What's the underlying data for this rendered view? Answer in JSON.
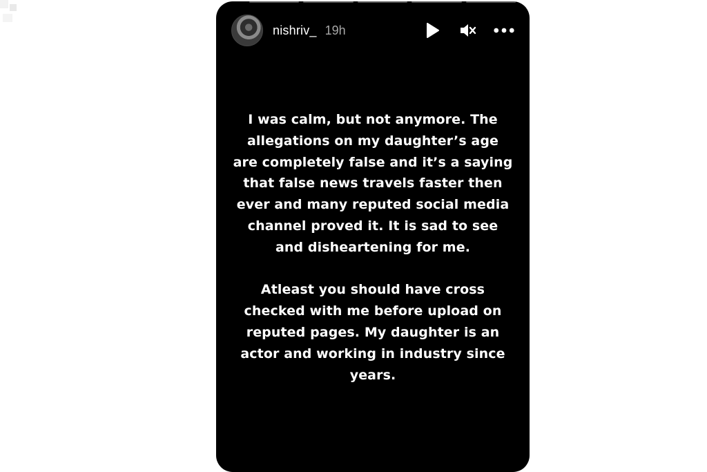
{
  "story": {
    "username": "nishriv_",
    "time_ago": "19h",
    "paragraphs": [
      "I was calm, but not anymore. The allegations on my daughter’s age are completely false and it’s a saying that false news travels faster then ever and many reputed social media channel proved it. It is sad to see and disheartening for me.",
      "Atleast you should have cross checked with me before upload on reputed pages. My daughter is an actor and working in industry since years."
    ],
    "icons": {
      "play": "play-icon",
      "mute": "mute-icon",
      "more": "more-options-icon"
    },
    "progress_segments": 5
  },
  "colors": {
    "page_background": "#ffffff",
    "story_background": "#000000",
    "text": "#ffffff",
    "time_text": "#a8a8a8"
  }
}
